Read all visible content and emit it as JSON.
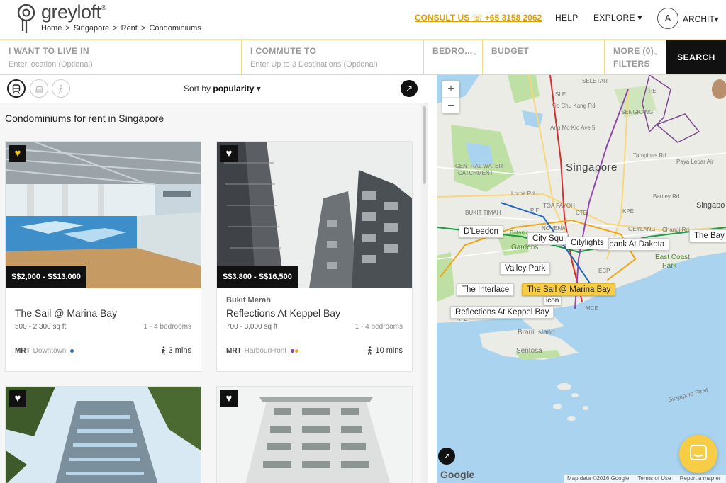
{
  "header": {
    "brand": "greyloft",
    "brand_mark": "®",
    "breadcrumb": [
      "Home",
      ">",
      "Singapore",
      ">",
      "Rent",
      ">",
      "Condominiums"
    ],
    "consult": "CONSULT US ☏ +65 3158 2062",
    "nav": {
      "help": "HELP",
      "explore": "EXPLORE ▾",
      "user": "ARCHIT▾"
    },
    "avatar_initial": "A"
  },
  "searchbar": {
    "live_label": "I WANT TO LIVE IN",
    "live_placeholder": "Enter location (Optional)",
    "commute_label": "I COMMUTE TO",
    "commute_placeholder": "Enter Up to 3 Destinations (Optional)",
    "bedrooms_label": "BEDRO...",
    "budget_label": "BUDGET",
    "more_label_1": "MORE (0)",
    "more_label_2": "FILTERS",
    "search_button": "SEARCH"
  },
  "toolbar": {
    "sort_prefix": "Sort by ",
    "sort_value": "popularity",
    "sort_chevron": "▾"
  },
  "list_title": "Condominiums for rent in Singapore",
  "listings": [
    {
      "price": "S$2,000 - S$13,000",
      "area": "",
      "name": "The Sail @ Marina Bay",
      "sqft": "500 - 2,300 sq ft",
      "beds": "1 - 4 bedrooms",
      "mrt_label": "MRT",
      "mrt_line": "Downtown",
      "walk": "3 mins",
      "favorited": true
    },
    {
      "price": "S$3,800 - S$16,500",
      "area": "Bukit Merah",
      "name": "Reflections At Keppel Bay",
      "sqft": "700 - 3,000 sq ft",
      "beds": "1 - 4 bedrooms",
      "mrt_label": "MRT",
      "mrt_line": "HarbourFront",
      "walk": "10 mins",
      "favorited": false
    },
    {
      "favorited": false
    },
    {
      "favorited": false
    }
  ],
  "map": {
    "zoom_in": "+",
    "zoom_out": "−",
    "city": "Singapore",
    "markers": [
      "D'Leedon",
      "City Squ",
      "Citylights",
      "erbank At Dakota",
      "The Bay",
      "Valley Park",
      "The Interlace",
      "The Sail @ Marina Bay",
      "Reflections At Keppel Bay",
      "icon"
    ],
    "labels": [
      "SELETAR",
      "SLE",
      "Yio Chu Kang Rd",
      "Ang Mo Kio Ave 5",
      "TPE",
      "SENGKANG",
      "Tampines Rd",
      "Paya Lebar Air",
      "CENTRAL WATER",
      "CATCHMENT",
      "Lorne Rd",
      "BUKIT TIMAH",
      "TOA PAYOH",
      "NOVENA",
      "Botanic",
      "Gardens",
      "East Coast",
      "Park",
      "Brani Island",
      "Sentosa",
      "Singapore Strait",
      "GEYLANG",
      "Changi Rd",
      "ECP",
      "PIE",
      "CTE",
      "KPE",
      "MCE",
      "AYE",
      "Bartley Rd",
      "Singapo"
    ],
    "google": "Google",
    "attribution": [
      "Map data ©2016 Google",
      "Terms of Use",
      "Report a map er"
    ]
  },
  "colors": {
    "accent_yellow": "#f7cd45",
    "consult_orange": "#e0a100",
    "black": "#111111"
  }
}
